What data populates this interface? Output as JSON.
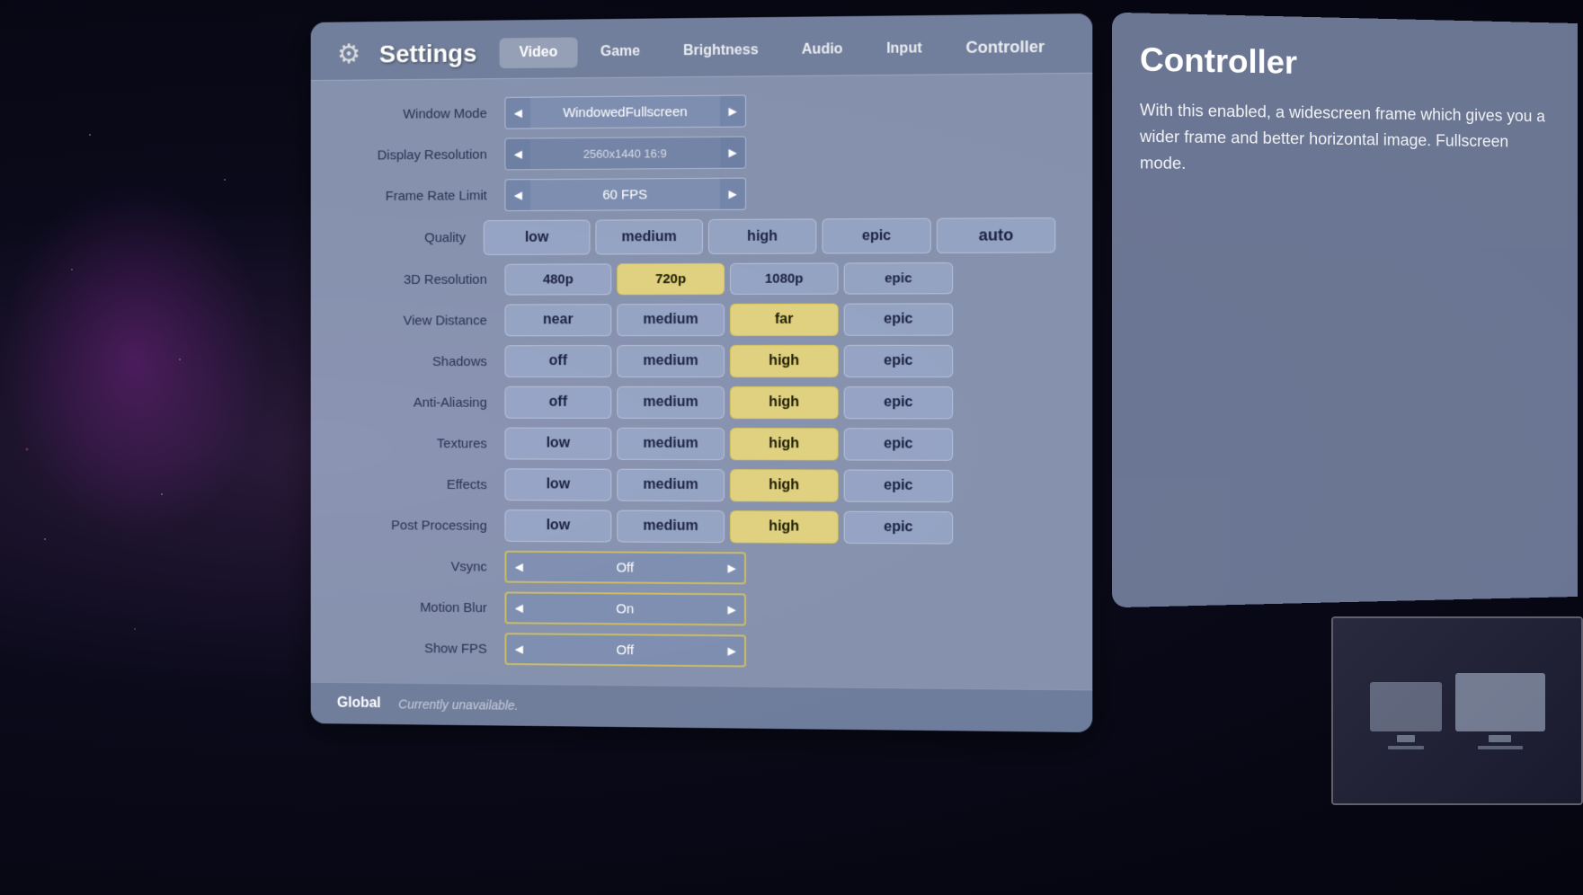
{
  "app": {
    "title": "Settings"
  },
  "header": {
    "gear_icon": "⚙",
    "title": "Settings",
    "tabs": [
      {
        "id": "video",
        "label": "Video",
        "active": true
      },
      {
        "id": "game",
        "label": "Game",
        "active": false
      },
      {
        "id": "brightness",
        "label": "Brightness",
        "active": false
      },
      {
        "id": "audio",
        "label": "Audio",
        "active": false
      },
      {
        "id": "input",
        "label": "Input",
        "active": false
      },
      {
        "id": "controller",
        "label": "Controller",
        "active": false
      }
    ]
  },
  "settings": {
    "window_mode": {
      "label": "Window Mode",
      "value": "WindowedFullscreen"
    },
    "display_resolution": {
      "label": "Display Resolution",
      "value": "2560x1440 16:9"
    },
    "frame_rate_limit": {
      "label": "Frame Rate Limit",
      "value": "60 FPS"
    },
    "quality": {
      "label": "Quality",
      "options": [
        "low",
        "medium",
        "high",
        "epic",
        "auto"
      ],
      "selected": null
    },
    "resolution_3d": {
      "label": "3D Resolution",
      "options": [
        "480p",
        "720p",
        "1080p",
        "epic"
      ],
      "selected": "720p"
    },
    "view_distance": {
      "label": "View Distance",
      "options": [
        "near",
        "medium",
        "far",
        "epic"
      ],
      "selected": "far"
    },
    "shadows": {
      "label": "Shadows",
      "options": [
        "off",
        "medium",
        "high",
        "epic"
      ],
      "selected": "high"
    },
    "anti_aliasing": {
      "label": "Anti-Aliasing",
      "options": [
        "off",
        "medium",
        "high",
        "epic"
      ],
      "selected": "high"
    },
    "textures": {
      "label": "Textures",
      "options": [
        "low",
        "medium",
        "high",
        "epic"
      ],
      "selected": "high"
    },
    "effects": {
      "label": "Effects",
      "options": [
        "low",
        "medium",
        "high",
        "epic"
      ],
      "selected": "high"
    },
    "post_processing": {
      "label": "Post Processing",
      "options": [
        "low",
        "medium",
        "high",
        "epic"
      ],
      "selected": "high"
    },
    "vsync": {
      "label": "Vsync",
      "value": "Off"
    },
    "motion_blur": {
      "label": "Motion Blur",
      "value": "On"
    },
    "show_fps": {
      "label": "Show FPS",
      "value": "Off"
    }
  },
  "footer": {
    "global_label": "Global",
    "status_text": "Currently unavailable."
  },
  "right_panel": {
    "title": "Controller",
    "description": "With this enabled, a widescreen frame which gives you a wider frame and better horizontal image. Fullscreen mode."
  },
  "arrows": {
    "left": "◀",
    "right": "▶"
  }
}
